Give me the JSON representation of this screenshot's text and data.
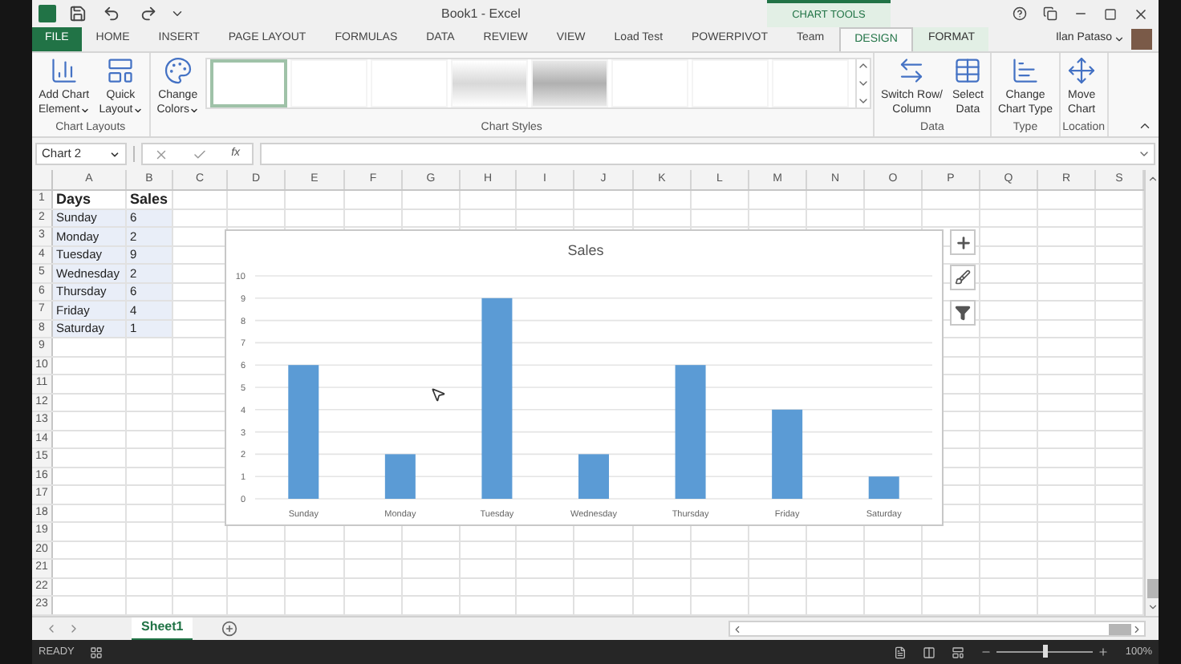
{
  "window": {
    "title": "Book1 - Excel",
    "context_label": "CHART TOOLS",
    "user": "Ilan Pataso"
  },
  "ribbon_tabs": [
    {
      "label": "FILE",
      "kind": "file",
      "selected": false
    },
    {
      "label": "HOME",
      "kind": "tab",
      "selected": false
    },
    {
      "label": "INSERT",
      "kind": "tab",
      "selected": false
    },
    {
      "label": "PAGE LAYOUT",
      "kind": "tab",
      "selected": false
    },
    {
      "label": "FORMULAS",
      "kind": "tab",
      "selected": false
    },
    {
      "label": "DATA",
      "kind": "tab",
      "selected": false
    },
    {
      "label": "REVIEW",
      "kind": "tab",
      "selected": false
    },
    {
      "label": "VIEW",
      "kind": "tab",
      "selected": false
    },
    {
      "label": "Load Test",
      "kind": "tab",
      "selected": false
    },
    {
      "label": "POWERPIVOT",
      "kind": "tab",
      "selected": false
    },
    {
      "label": "Team",
      "kind": "tab",
      "selected": false
    },
    {
      "label": "DESIGN",
      "kind": "context",
      "selected": true
    },
    {
      "label": "FORMAT",
      "kind": "context",
      "selected": false
    }
  ],
  "ribbon_groups": [
    {
      "label": "Chart Layouts",
      "buttons": [
        {
          "line1": "Add Chart",
          "line2": "Element",
          "dropdown": true
        },
        {
          "line1": "Quick",
          "line2": "Layout",
          "dropdown": true
        }
      ]
    },
    {
      "label": "Chart Styles",
      "buttons": [
        {
          "line1": "Change",
          "line2": "Colors",
          "dropdown": true
        }
      ],
      "styles": [
        {
          "kind": "plain",
          "selected": true
        },
        {
          "kind": "plain",
          "selected": false
        },
        {
          "kind": "plain",
          "selected": false
        },
        {
          "kind": "gradient",
          "selected": false
        },
        {
          "kind": "dark",
          "selected": false
        },
        {
          "kind": "plain",
          "selected": false
        },
        {
          "kind": "plain",
          "selected": false
        },
        {
          "kind": "plain",
          "selected": false
        }
      ]
    },
    {
      "label": "Data",
      "buttons": [
        {
          "line1": "Switch Row/",
          "line2": "Column",
          "dropdown": false
        },
        {
          "line1": "Select",
          "line2": "Data",
          "dropdown": false
        }
      ]
    },
    {
      "label": "Type",
      "buttons": [
        {
          "line1": "Change",
          "line2": "Chart Type",
          "dropdown": false
        }
      ]
    },
    {
      "label": "Location",
      "buttons": [
        {
          "line1": "Move",
          "line2": "Chart",
          "dropdown": false
        }
      ]
    }
  ],
  "formula_bar": {
    "name_box": "Chart 2",
    "function_label": "fx"
  },
  "sheet": {
    "columns": [
      "A",
      "B",
      "C",
      "D",
      "E",
      "F",
      "G",
      "H",
      "I",
      "J",
      "K",
      "L",
      "M",
      "N",
      "O",
      "P",
      "Q",
      "R",
      "S"
    ],
    "rows": [
      {
        "number": "1",
        "cells": [
          "Days",
          "Sales"
        ],
        "header": true,
        "selected": false
      },
      {
        "number": "2",
        "cells": [
          "Sunday",
          "6"
        ],
        "header": false,
        "selected": true
      },
      {
        "number": "3",
        "cells": [
          "Monday",
          "2"
        ],
        "header": false,
        "selected": true
      },
      {
        "number": "4",
        "cells": [
          "Tuesday",
          "9"
        ],
        "header": false,
        "selected": true
      },
      {
        "number": "5",
        "cells": [
          "Wednesday",
          "2"
        ],
        "header": false,
        "selected": true
      },
      {
        "number": "6",
        "cells": [
          "Thursday",
          "6"
        ],
        "header": false,
        "selected": true
      },
      {
        "number": "7",
        "cells": [
          "Friday",
          "4"
        ],
        "header": false,
        "selected": true
      },
      {
        "number": "8",
        "cells": [
          "Saturday",
          "1"
        ],
        "header": false,
        "selected": true
      },
      {
        "number": "9"
      },
      {
        "number": "10"
      },
      {
        "number": "11"
      },
      {
        "number": "12"
      },
      {
        "number": "13"
      },
      {
        "number": "14"
      },
      {
        "number": "15"
      },
      {
        "number": "16"
      },
      {
        "number": "17"
      },
      {
        "number": "18"
      },
      {
        "number": "19"
      },
      {
        "number": "20"
      },
      {
        "number": "21"
      },
      {
        "number": "22"
      },
      {
        "number": "23"
      }
    ]
  },
  "chart": {
    "chart_data": {
      "type": "bar",
      "title": "Sales",
      "categories": [
        "Sunday",
        "Monday",
        "Tuesday",
        "Wednesday",
        "Thursday",
        "Friday",
        "Saturday"
      ],
      "series": [
        {
          "color": "#5b9bd5",
          "values": [
            6,
            2,
            9,
            2,
            6,
            4,
            1
          ]
        }
      ],
      "ylim": [
        0,
        10
      ],
      "yticks": [
        0,
        1,
        2,
        3,
        4,
        5,
        6,
        7,
        8,
        9,
        10
      ],
      "grid": true
    }
  },
  "sheet_tabs": [
    {
      "label": "Sheet1",
      "selected": true
    }
  ],
  "status_bar": {
    "status": "READY",
    "zoom": "100%",
    "zoom_level": {
      "level": 0.5
    }
  }
}
